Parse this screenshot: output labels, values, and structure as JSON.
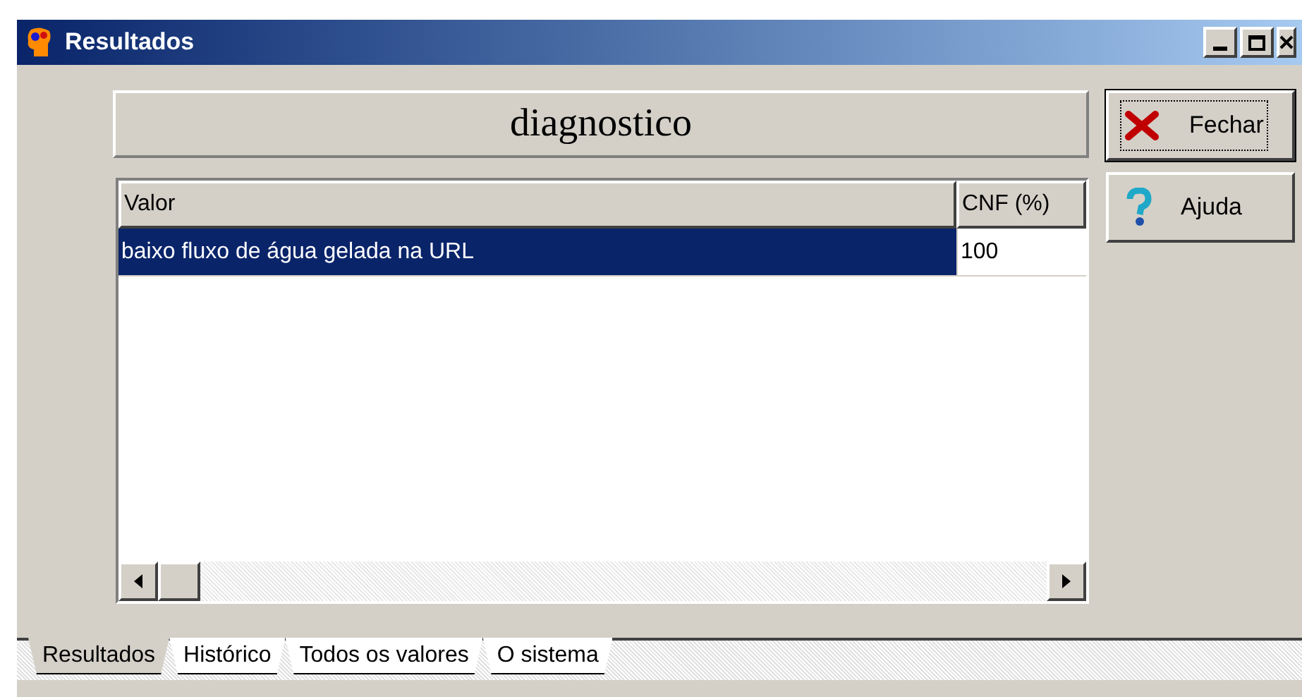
{
  "window": {
    "title": "Resultados"
  },
  "header": {
    "title": "diagnostico"
  },
  "table": {
    "columns": [
      "Valor",
      "CNF (%)"
    ],
    "rows": [
      {
        "cells": [
          "baixo fluxo de água gelada na URL",
          "100"
        ],
        "selected": true
      }
    ]
  },
  "buttons": [
    {
      "label": "Fechar",
      "kind": "close",
      "focused": true
    },
    {
      "label": "Ajuda",
      "kind": "help",
      "focused": false
    }
  ],
  "tabs": [
    {
      "label": "Resultados",
      "selected": true
    },
    {
      "label": "Histórico",
      "selected": false
    },
    {
      "label": "Todos os valores",
      "selected": false
    },
    {
      "label": "O sistema",
      "selected": false
    }
  ]
}
